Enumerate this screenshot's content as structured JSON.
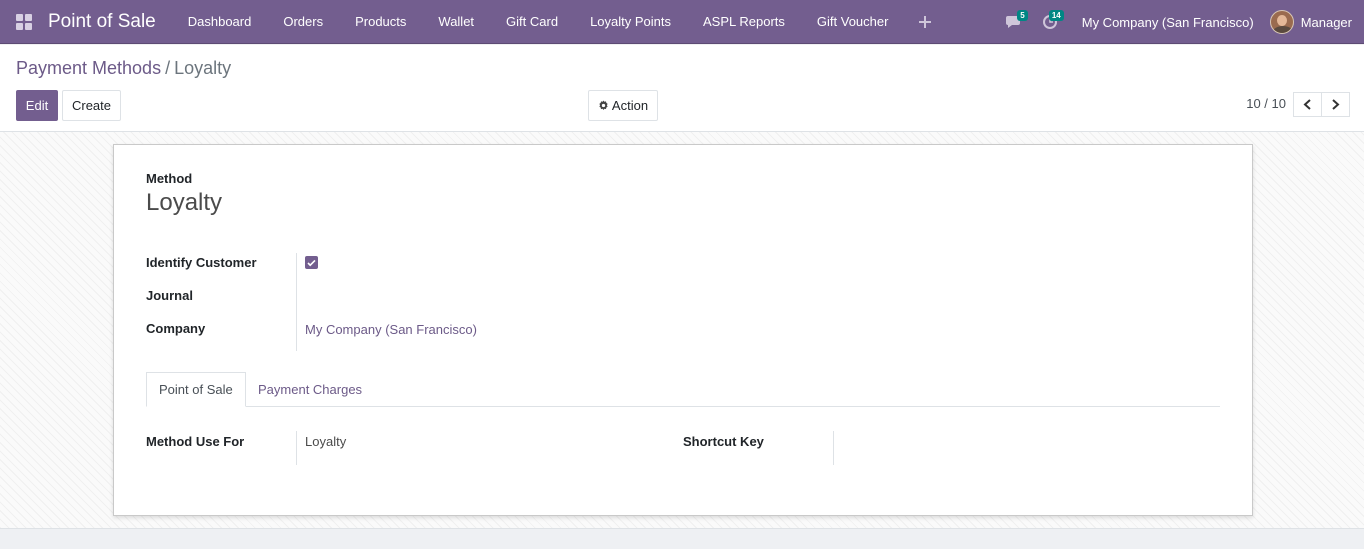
{
  "navbar": {
    "app_title": "Point of Sale",
    "menu": [
      "Dashboard",
      "Orders",
      "Products",
      "Wallet",
      "Gift Card",
      "Loyalty Points",
      "ASPL Reports",
      "Gift Voucher"
    ],
    "messages_badge": "5",
    "activities_badge": "14",
    "company": "My Company (San Francisco)",
    "user": "Manager"
  },
  "breadcrumb": {
    "parent": "Payment Methods",
    "separator": "/",
    "current": "Loyalty"
  },
  "toolbar": {
    "edit_label": "Edit",
    "create_label": "Create",
    "action_label": "Action"
  },
  "pager": {
    "value": "10 / 10"
  },
  "form": {
    "method_label": "Method",
    "method_value": "Loyalty",
    "identify_customer_label": "Identify Customer",
    "identify_customer_checked": true,
    "journal_label": "Journal",
    "journal_value": "",
    "company_label": "Company",
    "company_value": "My Company (San Francisco)",
    "tabs": [
      "Point of Sale",
      "Payment Charges"
    ],
    "active_tab": "Point of Sale",
    "method_use_for_label": "Method Use For",
    "method_use_for_value": "Loyalty",
    "shortcut_key_label": "Shortcut Key",
    "shortcut_key_value": ""
  },
  "colors": {
    "brand": "#735e8f",
    "link": "#6c5a88",
    "badge": "#008784"
  }
}
